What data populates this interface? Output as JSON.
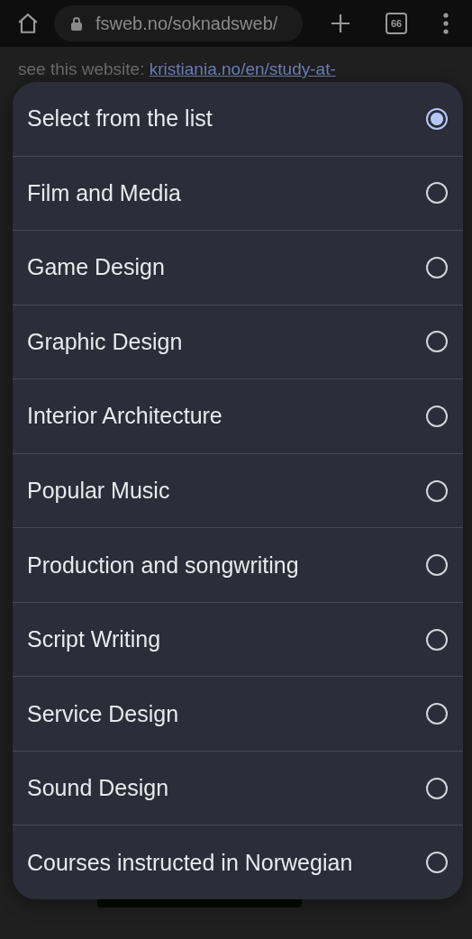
{
  "browser": {
    "url": "fsweb.no/soknadsweb/",
    "tab_count": "66"
  },
  "page": {
    "text": "see this website:",
    "link": "kristiania.no/en/study-at-"
  },
  "options": [
    {
      "label": "Select from the list",
      "selected": true
    },
    {
      "label": "Film and Media",
      "selected": false
    },
    {
      "label": "Game Design",
      "selected": false
    },
    {
      "label": "Graphic Design",
      "selected": false
    },
    {
      "label": "Interior Architecture",
      "selected": false
    },
    {
      "label": "Popular Music",
      "selected": false
    },
    {
      "label": "Production and songwriting",
      "selected": false
    },
    {
      "label": "Script Writing",
      "selected": false
    },
    {
      "label": "Service Design",
      "selected": false
    },
    {
      "label": "Sound Design",
      "selected": false
    },
    {
      "label": "Courses instructed in Norwegian",
      "selected": false
    }
  ]
}
